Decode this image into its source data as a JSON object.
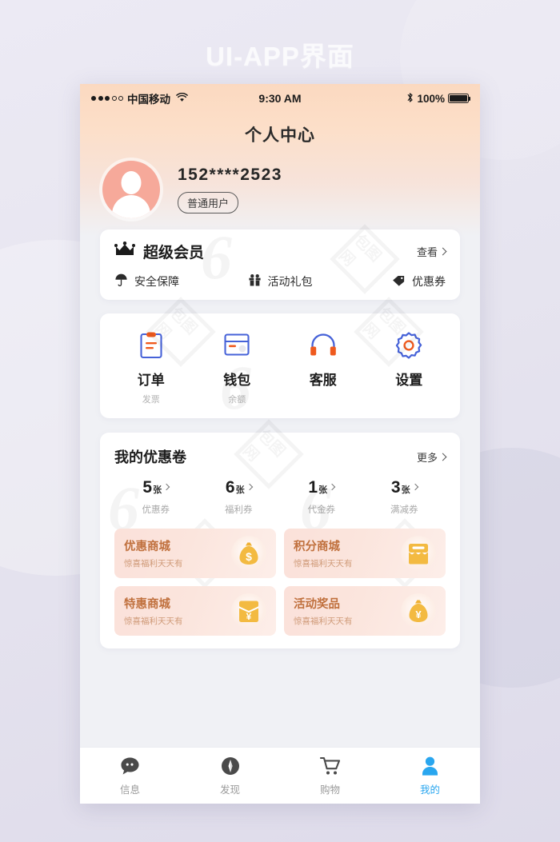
{
  "page": {
    "title": "UI-APP界面",
    "background_color": "#e8e7f1"
  },
  "statusbar": {
    "carrier": "中国移动",
    "time": "9:30 AM",
    "battery_percent": "100%",
    "wifi_icon": "wifi-icon",
    "bluetooth_icon": "bluetooth-icon",
    "signal_icon": "signal-dots-icon",
    "battery_icon": "battery-full-icon"
  },
  "nav": {
    "title": "个人中心"
  },
  "profile": {
    "avatar_icon": "user-avatar-icon",
    "avatar_color": "#f6a99a",
    "phone_number": "152****2523",
    "user_tag": "普通用户"
  },
  "vip": {
    "crown_icon": "crown-icon",
    "title": "超级会员",
    "more_label": "查看",
    "benefits": [
      {
        "icon": "umbrella-icon",
        "label": "安全保障"
      },
      {
        "icon": "gift-icon",
        "label": "活动礼包"
      },
      {
        "icon": "tag-icon",
        "label": "优惠券"
      }
    ]
  },
  "quick_actions": [
    {
      "icon": "clipboard-icon",
      "label": "订单",
      "sub": "发票"
    },
    {
      "icon": "wallet-card-icon",
      "label": "钱包",
      "sub": "余额"
    },
    {
      "icon": "headphones-icon",
      "label": "客服",
      "sub": ""
    },
    {
      "icon": "gear-icon",
      "label": "设置",
      "sub": ""
    }
  ],
  "coupons": {
    "title": "我的优惠卷",
    "more_label": "更多",
    "items": [
      {
        "count": "5",
        "unit": "张",
        "name": "优惠券"
      },
      {
        "count": "6",
        "unit": "张",
        "name": "福利券"
      },
      {
        "count": "1",
        "unit": "张",
        "name": "代金券"
      },
      {
        "count": "3",
        "unit": "张",
        "name": "满减券"
      }
    ]
  },
  "promos": [
    {
      "title": "优惠商城",
      "sub": "惊喜福利天天有",
      "icon": "money-bag-dollar-icon"
    },
    {
      "title": "积分商城",
      "sub": "惊喜福利天天有",
      "icon": "shop-store-icon"
    },
    {
      "title": "特惠商城",
      "sub": "惊喜福利天天有",
      "icon": "red-packet-yuan-icon"
    },
    {
      "title": "活动奖品",
      "sub": "惊喜福利天天有",
      "icon": "money-bag-yuan-icon"
    }
  ],
  "tabbar": {
    "active_color": "#29a6ef",
    "items": [
      {
        "icon": "chat-bubble-icon",
        "label": "信息",
        "active": false
      },
      {
        "icon": "compass-icon",
        "label": "发现",
        "active": false
      },
      {
        "icon": "shopping-cart-icon",
        "label": "购物",
        "active": false
      },
      {
        "icon": "person-icon",
        "label": "我的",
        "active": true
      }
    ]
  },
  "watermark": {
    "mark": "包图网",
    "glyph": "6"
  }
}
